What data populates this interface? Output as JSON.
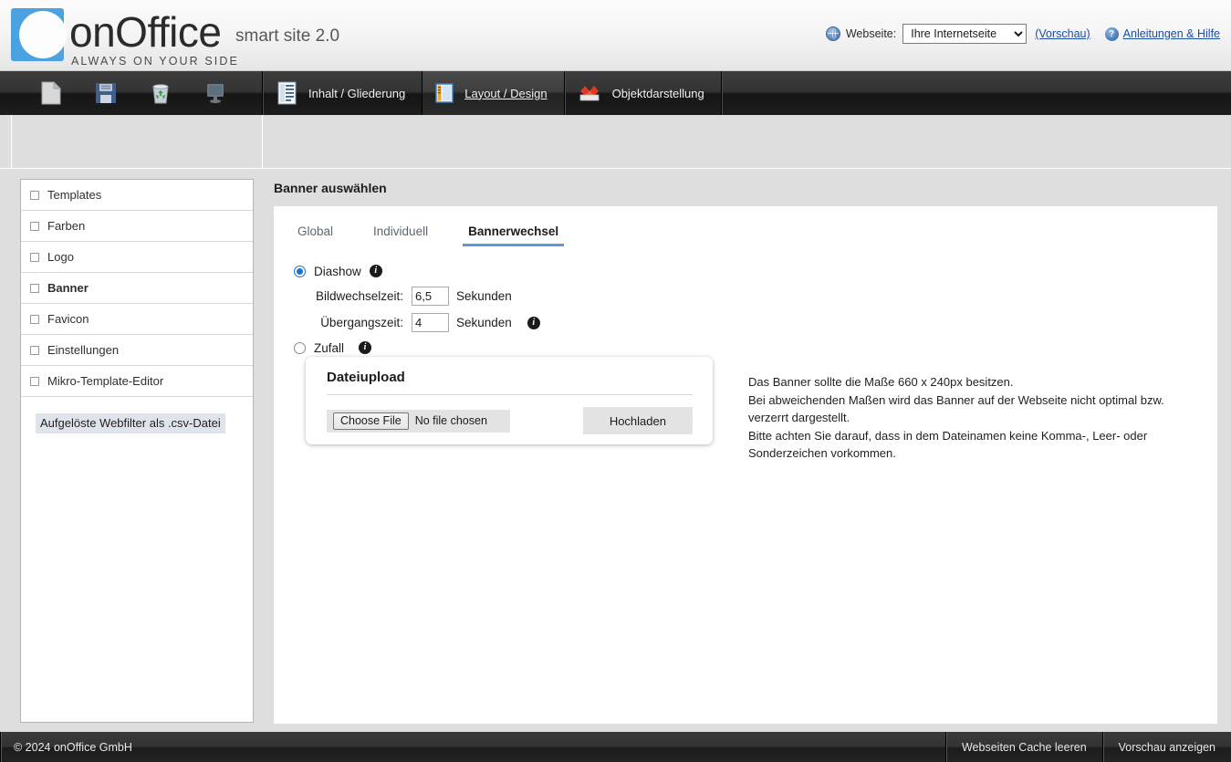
{
  "header": {
    "logo_word": "onOffice",
    "logo_tagline": "ALWAYS ON YOUR SIDE",
    "product": "smart site 2.0",
    "website_label": "Webseite:",
    "website_selected": "Ihre Internetseite",
    "website_options": [
      "Ihre Internetseite"
    ],
    "preview_link": "(Vorschau)",
    "help_link": "Anleitungen & Hilfe",
    "help_glyph": "?"
  },
  "toolbar": {
    "items": [
      {
        "icon": "new-page-icon"
      },
      {
        "icon": "save-floppy-icon"
      },
      {
        "icon": "recycle-bin-icon"
      },
      {
        "icon": "monitor-preview-icon"
      }
    ]
  },
  "nav": {
    "tabs": [
      {
        "label": "Inhalt / Gliederung",
        "icon": "content-outline-icon",
        "active": false
      },
      {
        "label": "Layout / Design",
        "icon": "layout-design-icon",
        "active": true
      },
      {
        "label": "Objektdarstellung",
        "icon": "object-display-icon",
        "active": false
      }
    ]
  },
  "sidebar": {
    "items": [
      {
        "label": "Templates",
        "selected": false
      },
      {
        "label": "Farben",
        "selected": false
      },
      {
        "label": "Logo",
        "selected": false
      },
      {
        "label": "Banner",
        "selected": true
      },
      {
        "label": "Favicon",
        "selected": false
      },
      {
        "label": "Einstellungen",
        "selected": false
      },
      {
        "label": "Mikro-Template-Editor",
        "selected": false
      }
    ],
    "csv_button": "Aufgelöste Webfilter als .csv-Datei"
  },
  "main": {
    "title": "Banner auswählen",
    "tabs": [
      {
        "label": "Global",
        "active": false
      },
      {
        "label": "Individuell",
        "active": false
      },
      {
        "label": "Bannerwechsel",
        "active": true
      }
    ],
    "options": {
      "diashow_label": "Diashow",
      "diashow_selected": true,
      "bildwechselzeit_label": "Bildwechselzeit:",
      "bildwechselzeit_value": "6,5",
      "bildwechselzeit_unit": "Sekunden",
      "uebergangszeit_label": "Übergangszeit:",
      "uebergangszeit_value": "4",
      "uebergangszeit_unit": "Sekunden",
      "zufall_label": "Zufall",
      "zufall_selected": false,
      "info_glyph": "i"
    },
    "upload": {
      "title": "Dateiupload",
      "choose_button": "Choose File",
      "file_status": "No file chosen",
      "upload_button": "Hochladen"
    },
    "hints": [
      "Das Banner sollte die Maße 660 x 240px besitzen.",
      "Bei abweichenden Maßen wird das Banner auf der Webseite nicht optimal bzw. verzerrt dargestellt.",
      "Bitte achten Sie darauf, dass in dem Dateinamen keine Komma-, Leer- oder Sonderzeichen vorkommen."
    ]
  },
  "footer": {
    "copyright": "© 2024 onOffice GmbH",
    "cache_button": "Webseiten Cache leeren",
    "preview_button": "Vorschau anzeigen"
  },
  "colors": {
    "accent_blue": "#5b9bd5",
    "logo_blue": "#4aa3e0",
    "radio_blue": "#1573d4",
    "link_blue": "#1b4fa0",
    "page_bg": "#dedede",
    "nav_dark": "#2b2b2b"
  }
}
